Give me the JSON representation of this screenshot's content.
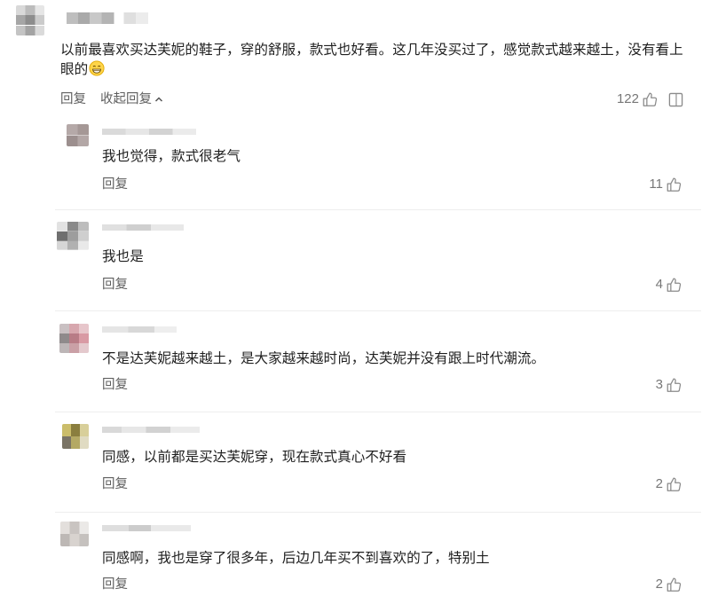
{
  "thread": {
    "comment": {
      "text": "以前最喜欢买达芙妮的鞋子，穿的舒服，款式也好看。这几年没买过了，感觉款式越来越土，没有看上眼的",
      "reply_label": "回复",
      "collapse_label": "收起回复",
      "likes": "122"
    },
    "replies": [
      {
        "text": "我也觉得，款式很老气",
        "reply_label": "回复",
        "likes": "11"
      },
      {
        "text": "我也是",
        "reply_label": "回复",
        "likes": "4"
      },
      {
        "text": "不是达芙妮越来越土，是大家越来越时尚，达芙妮并没有跟上时代潮流。",
        "reply_label": "回复",
        "likes": "3"
      },
      {
        "text": "同感，以前都是买达芙妮穿，现在款式真心不好看",
        "reply_label": "回复",
        "likes": "2"
      },
      {
        "text": "同感啊，我也是穿了很多年，后边几年买不到喜欢的了，特别土",
        "reply_label": "回复",
        "likes": "2"
      }
    ]
  },
  "icons": {
    "like": "thumbs-up",
    "collapse": "chevron-up",
    "comment": "comment-box",
    "emoji": "grinning-face"
  },
  "colors": {
    "background": "#ffffff",
    "text": "#1f1f1f",
    "secondary_text": "#5f5f5f",
    "count_text": "#777777",
    "divider": "#eeeeee"
  }
}
